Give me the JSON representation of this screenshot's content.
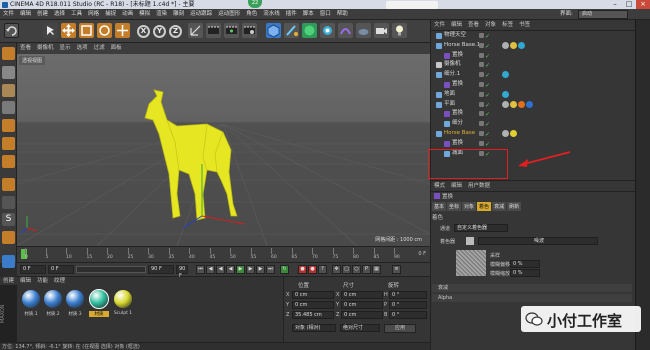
{
  "window": {
    "title": "CINEMA 4D R18.011 Studio (RC - R18) - [未标题 1.c4d *] - 主要",
    "badge": "22"
  },
  "menubar": {
    "items": [
      "文件",
      "编辑",
      "创建",
      "选择",
      "工具",
      "网格",
      "捕捉",
      "动画",
      "模拟",
      "渲染",
      "雕刻",
      "运动跟踪",
      "运动图形",
      "角色",
      "流水线",
      "插件",
      "脚本",
      "窗口",
      "帮助"
    ],
    "layout_label": "界面:",
    "layout_value": "启动"
  },
  "toolbar": {
    "axes": [
      "X",
      "Y",
      "Z"
    ]
  },
  "viewport": {
    "menu": [
      "查看",
      "摄像机",
      "显示",
      "选项",
      "过滤",
      "面板"
    ],
    "label": "透视视图",
    "grid_text": "网格间距 : 1000 cm"
  },
  "timeline": {
    "ticks": [
      "0",
      "5",
      "10",
      "15",
      "20",
      "25",
      "30",
      "35",
      "40",
      "45",
      "50",
      "55",
      "60",
      "65",
      "70",
      "75",
      "80",
      "85",
      "90"
    ],
    "end": "0 F"
  },
  "controls": {
    "start": "0 F",
    "min": "0 F",
    "max": "90 F",
    "end": "90 F"
  },
  "materials": {
    "menu": [
      "创建",
      "编辑",
      "功能",
      "纹理"
    ],
    "items": [
      {
        "label": "材质.1",
        "color": "#3b7fd0"
      },
      {
        "label": "材质.2",
        "color": "#3b7fd0"
      },
      {
        "label": "材质.3",
        "color": "#3b7fd0"
      },
      {
        "label": "材质",
        "color": "#30c0a0"
      },
      {
        "label": "Sculpt 1",
        "color": "#d8d830"
      }
    ]
  },
  "coords": {
    "headers": [
      "位置",
      "尺寸",
      "旋转"
    ],
    "rows": [
      {
        "p": "X",
        "pv": "0 cm",
        "s": "X",
        "sv": "0 cm",
        "r": "H",
        "rv": "0 °"
      },
      {
        "p": "Y",
        "pv": "0 cm",
        "s": "Y",
        "sv": "0 cm",
        "r": "P",
        "rv": "0 °"
      },
      {
        "p": "Z",
        "pv": "35.485 cm",
        "s": "Z",
        "sv": "0 cm",
        "r": "B",
        "rv": "0 °"
      }
    ],
    "mode1": "对象 (相对)",
    "mode2": "绝对尺寸",
    "apply": "应用"
  },
  "status": {
    "text": "方位: 134.7°, 倾斜: -6.1°  旋转: 在 (在视图 选择) 对象 (框选)"
  },
  "objects": {
    "menu": [
      "文件",
      "编辑",
      "查看",
      "对象",
      "标签",
      "书签"
    ],
    "rows": [
      {
        "name": "物理天空",
        "indent": 0,
        "icon": "#6fa8dc",
        "tags": []
      },
      {
        "name": "Horse Base.1",
        "indent": 0,
        "icon": "#6fa8dc",
        "tags": [
          "#b0b0b0",
          "#e0c040",
          "#30a8d0"
        ]
      },
      {
        "name": "置换",
        "indent": 1,
        "icon": "#7a4fbf",
        "tags": []
      },
      {
        "name": "摄像机",
        "indent": 0,
        "icon": "#c8c8c8",
        "tags": []
      },
      {
        "name": "细分.1",
        "indent": 0,
        "icon": "#6fa8dc",
        "tags": [
          "#30a8d0"
        ]
      },
      {
        "name": "置换",
        "indent": 1,
        "icon": "#7a4fbf",
        "tags": []
      },
      {
        "name": "地面",
        "indent": 0,
        "icon": "#6fa8dc",
        "tags": [
          "#30a8d0"
        ]
      },
      {
        "name": "平面",
        "indent": 0,
        "icon": "#6fa8dc",
        "tags": [
          "#b0b0b0",
          "#e0c040",
          "#e07020",
          "#3070d0"
        ]
      },
      {
        "name": "置换",
        "indent": 1,
        "icon": "#7a4fbf",
        "tags": []
      },
      {
        "name": "细分",
        "indent": 1,
        "icon": "#6fa8dc",
        "tags": []
      },
      {
        "name": "Horse Base",
        "indent": 0,
        "icon": "#6fa8dc",
        "tags": [
          "#b0b0b0",
          "#e0d030"
        ],
        "highlight": true
      },
      {
        "name": "置换",
        "indent": 1,
        "icon": "#7a4fbf",
        "tags": []
      },
      {
        "name": "减面",
        "indent": 1,
        "icon": "#6fa8dc",
        "tags": []
      }
    ]
  },
  "attributes": {
    "menu": [
      "模式",
      "编辑",
      "用户数据"
    ],
    "object_title": "置换",
    "tabs": [
      "基本",
      "坐标",
      "对象",
      "着色",
      "衰减",
      "刷新"
    ],
    "active_tab": "着色",
    "section": "着色",
    "channel_label": "通道",
    "channel_value": "自定义着色器",
    "shader_label": "着色器",
    "shader_value": "噪波",
    "sample_label": "采样",
    "blur_label": "模糊偏移",
    "blur_value": "0 %",
    "scale_label": "模糊缩放",
    "scale_value": "0 %",
    "fold1": "衰减",
    "fold2": "Alpha"
  },
  "watermark": {
    "text": "小付工作室"
  }
}
